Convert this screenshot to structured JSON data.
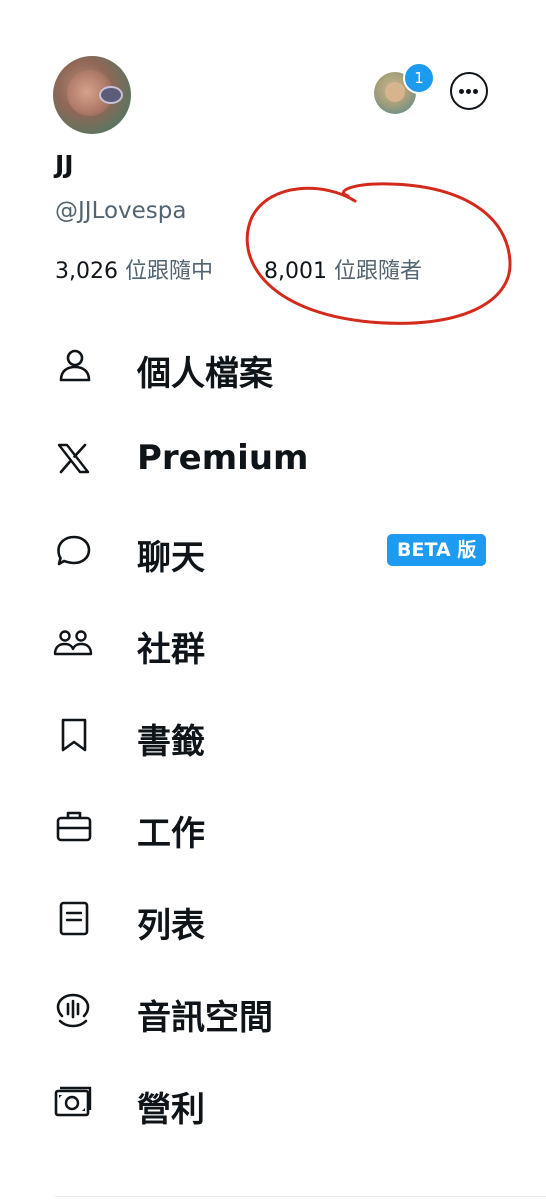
{
  "profile": {
    "display_name": "JJ",
    "handle": "@JJLovespa",
    "following_count": "3,026",
    "following_label": " 位跟隨中",
    "followers_count": "8,001",
    "followers_label": " 位跟隨者",
    "notification_badge": "1"
  },
  "menu": {
    "items": [
      {
        "label": "個人檔案",
        "icon": "person-icon"
      },
      {
        "label": "Premium",
        "icon": "x-logo-icon"
      },
      {
        "label": "聊天",
        "icon": "chat-bubble-icon",
        "badge": "BETA 版"
      },
      {
        "label": "社群",
        "icon": "communities-icon"
      },
      {
        "label": "書籤",
        "icon": "bookmark-icon"
      },
      {
        "label": "工作",
        "icon": "briefcase-icon"
      },
      {
        "label": "列表",
        "icon": "list-icon"
      },
      {
        "label": "音訊空間",
        "icon": "spaces-icon"
      },
      {
        "label": "營利",
        "icon": "monetization-icon"
      }
    ]
  },
  "colors": {
    "accent": "#1d9bf0",
    "text_primary": "#0f1419",
    "text_secondary": "#536471",
    "annotation_red": "#d42a1c"
  }
}
